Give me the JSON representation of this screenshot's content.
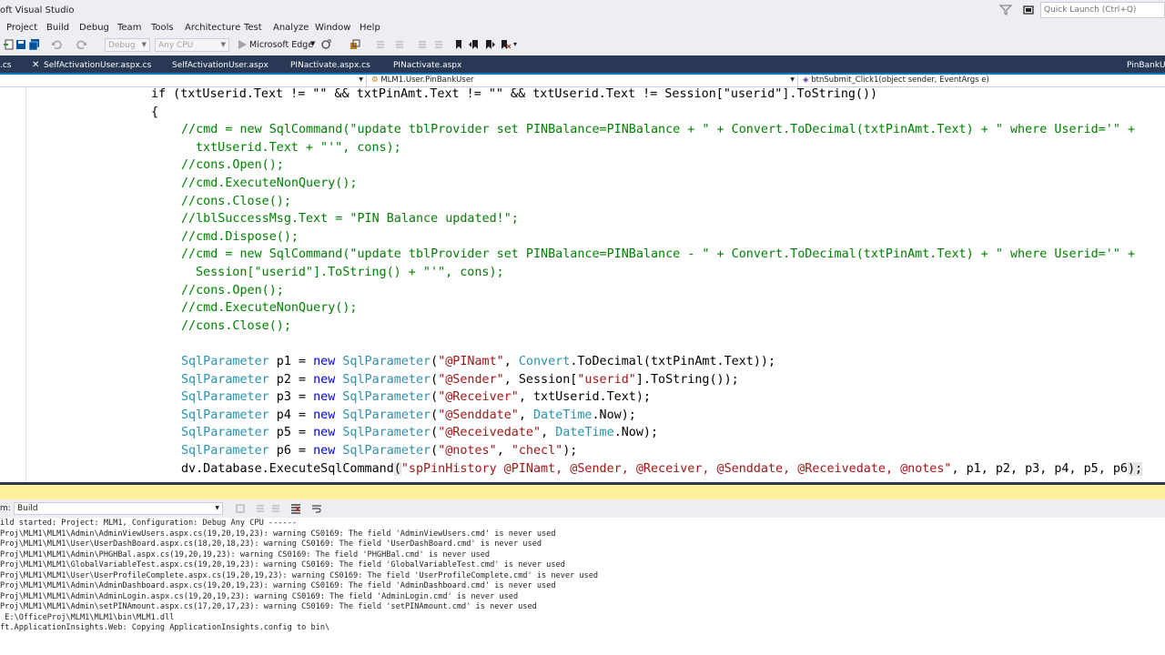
{
  "window": {
    "title": "oft Visual Studio",
    "quick_launch_placeholder": "Quick Launch (Ctrl+Q)"
  },
  "menu": [
    "Project",
    "Build",
    "Debug",
    "Team",
    "Tools",
    "Architecture",
    "Test",
    "Analyze",
    "Window",
    "Help"
  ],
  "toolbar": {
    "config": "Debug",
    "platform": "Any CPU",
    "run_target": "Microsoft Edge"
  },
  "tabs": [
    {
      "label": ".cs"
    },
    {
      "label": "SelfActivationUser.aspx.cs"
    },
    {
      "label": "SelfActivationUser.aspx"
    },
    {
      "label": "PINactivate.aspx.cs"
    },
    {
      "label": "PINactivate.aspx"
    },
    {
      "label": "PinBankU"
    }
  ],
  "navbar": {
    "project": "",
    "class": "MLM1.User.PinBankUser",
    "member": "btnSubmit_Click1(object sender, EventArgs e)"
  },
  "code": [
    [
      [
        "if (txtUserid.Text != \"\" && txtPinAmt.Text != \"\" && txtUserid.Text != Session[\"userid\"].ToString())",
        "plain"
      ]
    ],
    [
      [
        "{",
        "plain"
      ]
    ],
    [
      [
        "//cmd = new SqlCommand(\"update tblProvider set PINBalance=PINBalance + \" + Convert.ToDecimal(txtPinAmt.Text) + \" where Userid='\" +",
        "cmt"
      ]
    ],
    [
      [
        "txtUserid.Text + \"'\", cons);",
        "cmt"
      ]
    ],
    [
      [
        "//cons.Open();",
        "cmt"
      ]
    ],
    [
      [
        "//cmd.ExecuteNonQuery();",
        "cmt"
      ]
    ],
    [
      [
        "//cons.Close();",
        "cmt"
      ]
    ],
    [
      [
        "//lblSuccessMsg.Text = \"PIN Balance updated!\";",
        "cmt"
      ]
    ],
    [
      [
        "//cmd.Dispose();",
        "cmt"
      ]
    ],
    [
      [
        "//cmd = new SqlCommand(\"update tblProvider set PINBalance=PINBalance - \" + Convert.ToDecimal(txtPinAmt.Text) + \" where Userid='\" +",
        "cmt"
      ]
    ],
    [
      [
        "Session[\"userid\"].ToString() + \"'\", cons);",
        "cmt"
      ]
    ],
    [
      [
        "//cons.Open();",
        "cmt"
      ]
    ],
    [
      [
        "//cmd.ExecuteNonQuery();",
        "cmt"
      ]
    ],
    [
      [
        "//cons.Close();",
        "cmt"
      ]
    ],
    [
      [
        "",
        "plain"
      ]
    ],
    [
      [
        "SqlParameter",
        "type"
      ],
      [
        " p1 = ",
        "plain"
      ],
      [
        "new",
        "kw"
      ],
      [
        " ",
        "plain"
      ],
      [
        "SqlParameter",
        "type"
      ],
      [
        "(",
        "plain"
      ],
      [
        "\"@PINamt\"",
        "str"
      ],
      [
        ", ",
        "plain"
      ],
      [
        "Convert",
        "type"
      ],
      [
        ".ToDecimal(txtPinAmt.Text));",
        "plain"
      ]
    ],
    [
      [
        "SqlParameter",
        "type"
      ],
      [
        " p2 = ",
        "plain"
      ],
      [
        "new",
        "kw"
      ],
      [
        " ",
        "plain"
      ],
      [
        "SqlParameter",
        "type"
      ],
      [
        "(",
        "plain"
      ],
      [
        "\"@Sender\"",
        "str"
      ],
      [
        ", Session[",
        "plain"
      ],
      [
        "\"userid\"",
        "str"
      ],
      [
        "].ToString());",
        "plain"
      ]
    ],
    [
      [
        "SqlParameter",
        "type"
      ],
      [
        " p3 = ",
        "plain"
      ],
      [
        "new",
        "kw"
      ],
      [
        " ",
        "plain"
      ],
      [
        "SqlParameter",
        "type"
      ],
      [
        "(",
        "plain"
      ],
      [
        "\"@Receiver\"",
        "str"
      ],
      [
        ", txtUserid.Text);",
        "plain"
      ]
    ],
    [
      [
        "SqlParameter",
        "type"
      ],
      [
        " p4 = ",
        "plain"
      ],
      [
        "new",
        "kw"
      ],
      [
        " ",
        "plain"
      ],
      [
        "SqlParameter",
        "type"
      ],
      [
        "(",
        "plain"
      ],
      [
        "\"@Senddate\"",
        "str"
      ],
      [
        ", ",
        "plain"
      ],
      [
        "DateTime",
        "type"
      ],
      [
        ".Now);",
        "plain"
      ]
    ],
    [
      [
        "SqlParameter",
        "type"
      ],
      [
        " p5 = ",
        "plain"
      ],
      [
        "new",
        "kw"
      ],
      [
        " ",
        "plain"
      ],
      [
        "SqlParameter",
        "type"
      ],
      [
        "(",
        "plain"
      ],
      [
        "\"@Receivedate\"",
        "str"
      ],
      [
        ", ",
        "plain"
      ],
      [
        "DateTime",
        "type"
      ],
      [
        ".Now);",
        "plain"
      ]
    ],
    [
      [
        "SqlParameter",
        "type"
      ],
      [
        " p6 = ",
        "plain"
      ],
      [
        "new",
        "kw"
      ],
      [
        " ",
        "plain"
      ],
      [
        "SqlParameter",
        "type"
      ],
      [
        "(",
        "plain"
      ],
      [
        "\"@notes\"",
        "str"
      ],
      [
        ", ",
        "plain"
      ],
      [
        "\"checl\"",
        "str"
      ],
      [
        ");",
        "plain"
      ]
    ],
    [
      [
        "dv.Database.ExecuteSqlCommand",
        "plain"
      ],
      [
        "(",
        "sel"
      ],
      [
        "\"spPinHistory @PINamt, @Sender, @Receiver, @Senddate, @Receivedate, @notes\"",
        "str"
      ],
      [
        ", p1, p2, p3, p4, p5, p6",
        "plain"
      ],
      [
        ");",
        "sel"
      ]
    ]
  ],
  "output": {
    "show_from_label": "m:",
    "show_from_value": "Build",
    "lines": [
      "ild started: Project: MLM1, Configuration: Debug Any CPU ------",
      "Proj\\MLM1\\MLM1\\Admin\\AdminViewUsers.aspx.cs(19,20,19,23): warning CS0169: The field 'AdminViewUsers.cmd' is never used",
      "Proj\\MLM1\\MLM1\\User\\UserDashBoard.aspx.cs(18,20,18,23): warning CS0169: The field 'UserDashBoard.cmd' is never used",
      "Proj\\MLM1\\MLM1\\Admin\\PHGHBal.aspx.cs(19,20,19,23): warning CS0169: The field 'PHGHBal.cmd' is never used",
      "Proj\\MLM1\\MLM1\\GlobalVariableTest.aspx.cs(19,20,19,23): warning CS0169: The field 'GlobalVariableTest.cmd' is never used",
      "Proj\\MLM1\\MLM1\\User\\UserProfileComplete.aspx.cs(19,20,19,23): warning CS0169: The field 'UserProfileComplete.cmd' is never used",
      "Proj\\MLM1\\MLM1\\Admin\\AdminDashboard.aspx.cs(19,20,19,23): warning CS0169: The field 'AdminDashboard.cmd' is never used",
      "Proj\\MLM1\\MLM1\\Admin\\AdminLogin.aspx.cs(19,20,19,23): warning CS0169: The field 'AdminLogin.cmd' is never used",
      "Proj\\MLM1\\MLM1\\Admin\\setPINAmount.aspx.cs(17,20,17,23): warning CS0169: The field 'setPINAmount.cmd' is never used",
      " E:\\OfficeProj\\MLM1\\MLM1\\bin\\MLM1.dll",
      "ft.ApplicationInsights.Web: Copying ApplicationInsights.config to bin\\"
    ]
  }
}
